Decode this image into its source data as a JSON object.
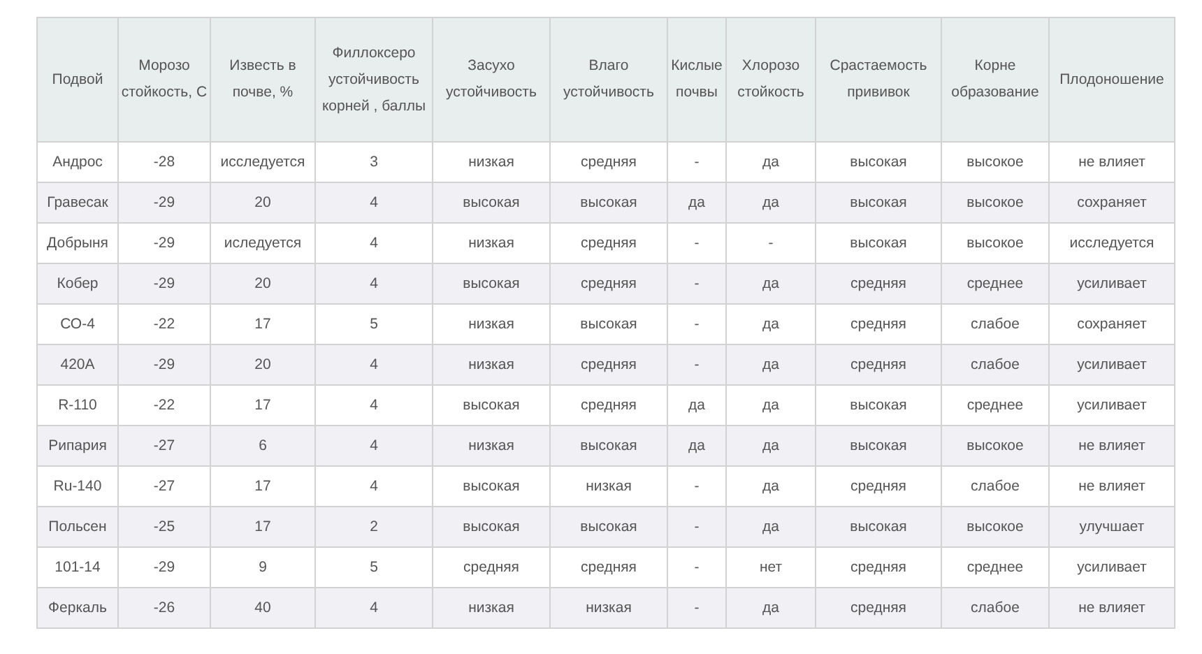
{
  "table": {
    "columns": [
      "Подвой",
      "Морозо стойкость, С",
      "Известь в почве, %",
      "Филлоксеро устойчивость корней , баллы",
      "Засухо устойчивость",
      "Влаго устойчивость",
      "Кислые почвы",
      "Хлорозо стойкость",
      "Срастаемость прививок",
      "Корне образование",
      "Плодоношение"
    ],
    "rows": [
      [
        "Андрос",
        "-28",
        "исследуется",
        "3",
        "низкая",
        "средняя",
        "-",
        "да",
        "высокая",
        "высокое",
        "не влияет"
      ],
      [
        "Гравесак",
        "-29",
        "20",
        "4",
        "высокая",
        "высокая",
        "да",
        "да",
        "высокая",
        "высокое",
        "сохраняет"
      ],
      [
        "Добрыня",
        "-29",
        "иследуется",
        "4",
        "низкая",
        "средняя",
        "-",
        "-",
        "высокая",
        "высокое",
        "исследуется"
      ],
      [
        "Кобер",
        "-29",
        "20",
        "4",
        "высокая",
        "средняя",
        "-",
        "да",
        "средняя",
        "среднее",
        "усиливает"
      ],
      [
        "СО-4",
        "-22",
        "17",
        "5",
        "низкая",
        "высокая",
        "-",
        "да",
        "средняя",
        "слабое",
        "сохраняет"
      ],
      [
        "420А",
        "-29",
        "20",
        "4",
        "низкая",
        "средняя",
        "-",
        "да",
        "средняя",
        "слабое",
        "усиливает"
      ],
      [
        "R-110",
        "-22",
        "17",
        "4",
        "высокая",
        "средняя",
        "да",
        "да",
        "высокая",
        "среднее",
        "усиливает"
      ],
      [
        "Рипария",
        "-27",
        "6",
        "4",
        "низкая",
        "высокая",
        "да",
        "да",
        "высокая",
        "высокое",
        "не влияет"
      ],
      [
        "Ru-140",
        "-27",
        "17",
        "4",
        "высокая",
        "низкая",
        "-",
        "да",
        "средняя",
        "слабое",
        "не влияет"
      ],
      [
        "Польсен",
        "-25",
        "17",
        "2",
        "высокая",
        "высокая",
        "-",
        "да",
        "высокая",
        "высокое",
        "улучшает"
      ],
      [
        "101-14",
        "-29",
        "9",
        "5",
        "средняя",
        "средняя",
        "-",
        "нет",
        "средняя",
        "среднее",
        "усиливает"
      ],
      [
        "Феркаль",
        "-26",
        "40",
        "4",
        "низкая",
        "низкая",
        "-",
        "да",
        "средняя",
        "слабое",
        "не влияет"
      ]
    ]
  }
}
